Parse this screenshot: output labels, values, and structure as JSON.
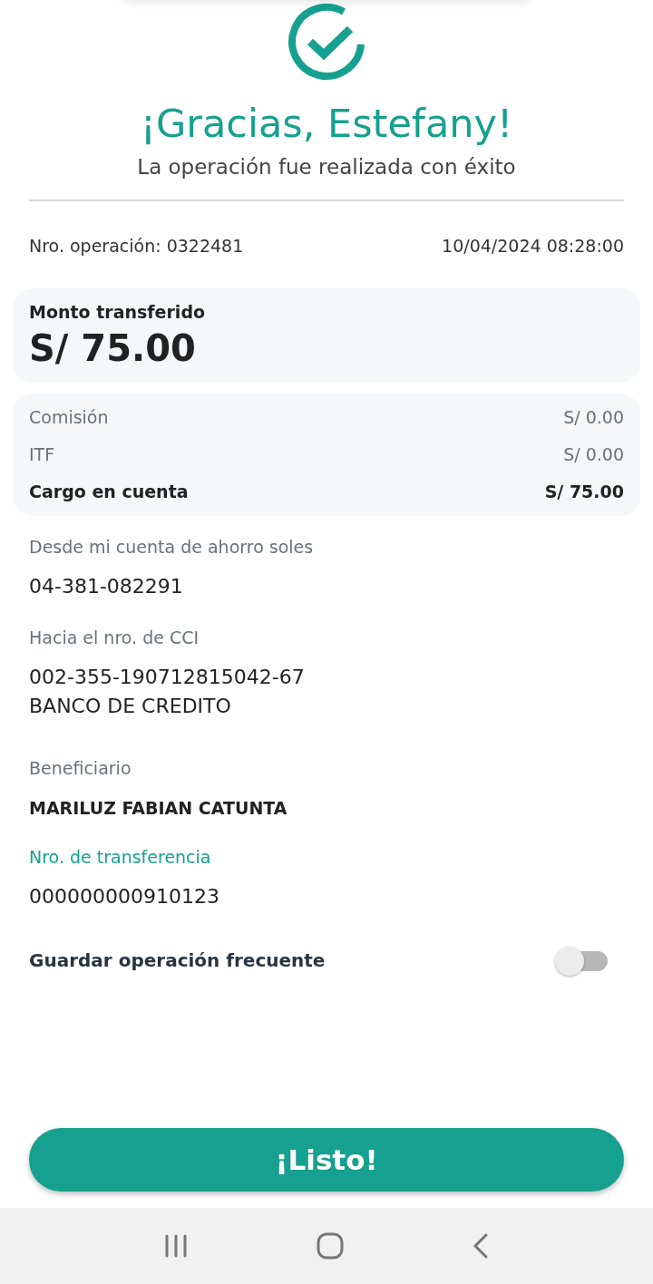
{
  "header": {
    "title": "¡Gracias, Estefany!",
    "subtitle": "La operación fue realizada con éxito"
  },
  "operation": {
    "number": "Nro. operación: 0322481",
    "datetime": "10/04/2024 08:28:00"
  },
  "amount": {
    "label": "Monto transferido",
    "value": "S/ 75.00"
  },
  "charges": [
    {
      "label": "Comisión",
      "value": "S/ 0.00",
      "bold": false
    },
    {
      "label": "ITF",
      "value": "S/ 0.00",
      "bold": false
    },
    {
      "label": "Cargo en cuenta",
      "value": "S/ 75.00",
      "bold": true
    }
  ],
  "details": [
    {
      "label": "Desde mi cuenta de ahorro soles",
      "lines": [
        "04-381-082291"
      ],
      "highlight": false,
      "bold": false
    },
    {
      "label": "Hacia el nro. de CCI",
      "lines": [
        "002-355-190712815042-67",
        "BANCO DE CREDITO"
      ],
      "highlight": false,
      "bold": false
    },
    {
      "label": "Beneficiario",
      "lines": [
        "MARILUZ FABIAN CATUNTA"
      ],
      "highlight": false,
      "bold": true
    },
    {
      "label": "Nro. de transferencia",
      "lines": [
        "000000000910123"
      ],
      "highlight": true,
      "bold": false
    }
  ],
  "frequent": {
    "label": "Guardar operación frecuente",
    "on": false
  },
  "button": "¡Listo!"
}
